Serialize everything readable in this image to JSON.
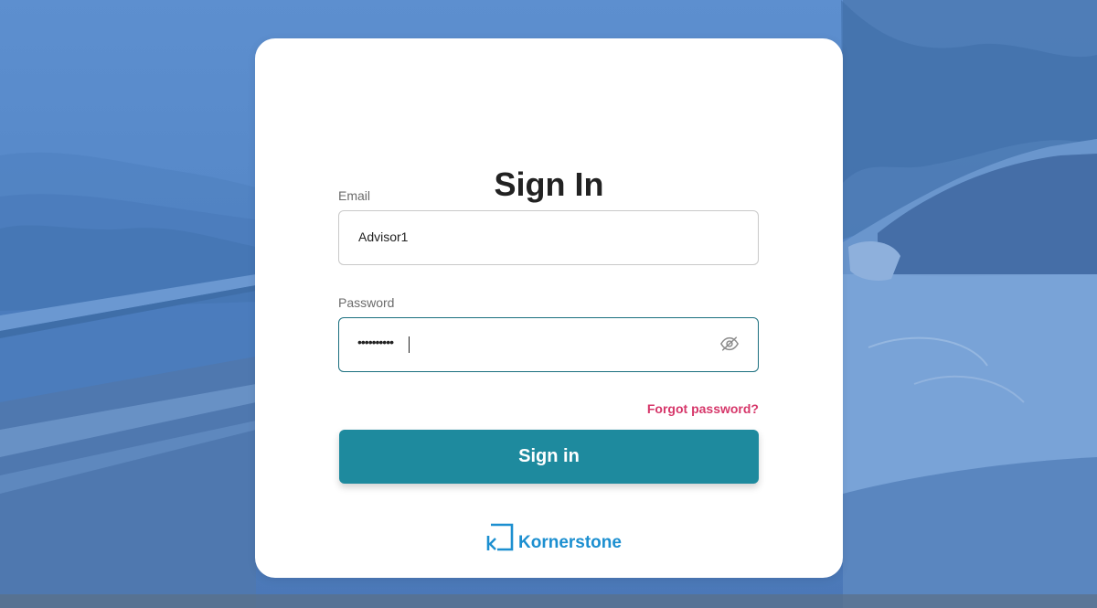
{
  "page": {
    "title": "Sign In"
  },
  "form": {
    "email_label": "Email",
    "email_value": "Advisor1",
    "password_label": "Password",
    "password_masked": "••••••••••",
    "forgot_password": "Forgot password?",
    "submit_label": "Sign in"
  },
  "brand": {
    "name": "Kornerstone"
  },
  "icons": {
    "password_toggle": "eye-slash-icon",
    "logo": "kornerstone-logo-icon"
  },
  "colors": {
    "primary_button": "#1e8a9e",
    "link": "#d6376a",
    "brand": "#1c8fd0",
    "focus_border": "#1b6f7f",
    "background_tint": "#5688c8"
  }
}
